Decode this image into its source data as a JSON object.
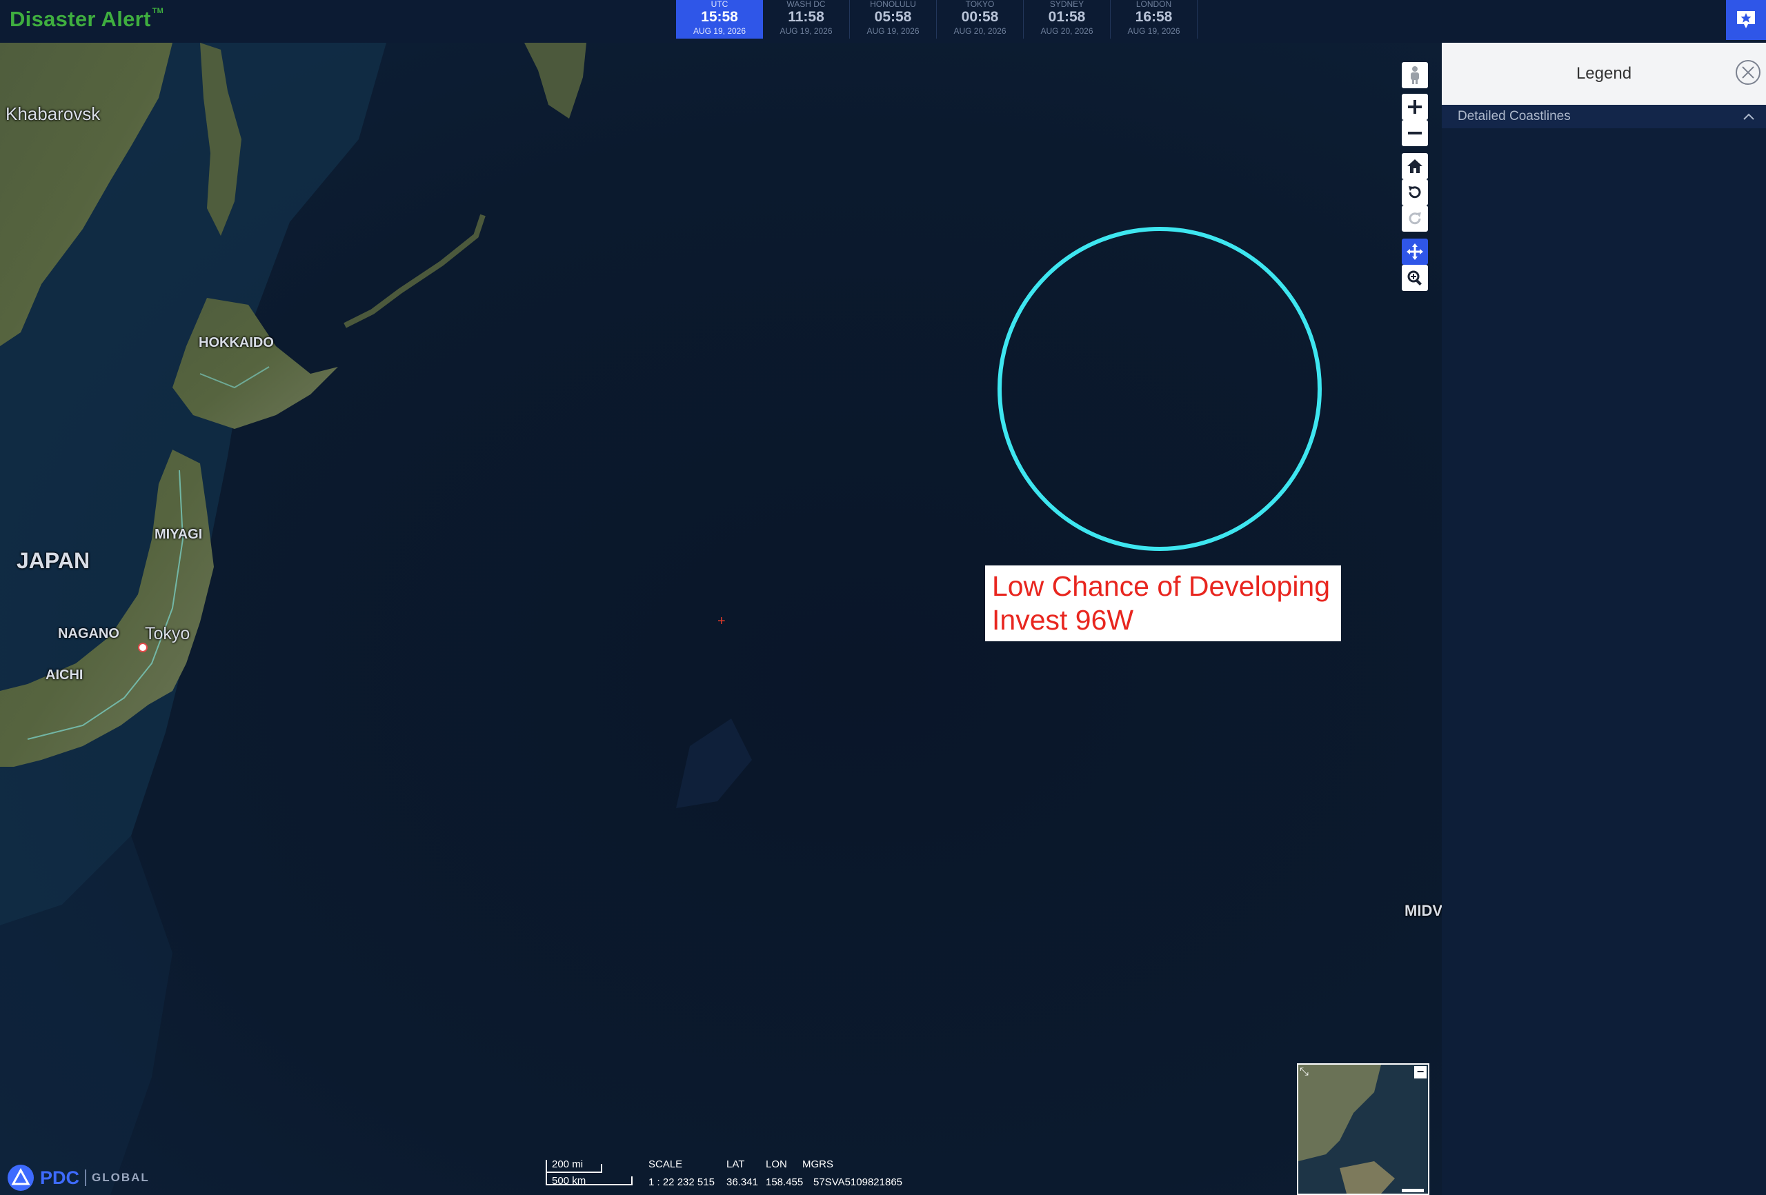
{
  "app": {
    "title": "Disaster Alert",
    "trademark": "TM"
  },
  "clocks": [
    {
      "zone": "UTC",
      "time": "15:58",
      "date": "AUG 19, 2026",
      "active": true
    },
    {
      "zone": "WASH DC",
      "time": "11:58",
      "date": "AUG 19, 2026"
    },
    {
      "zone": "HONOLULU",
      "time": "05:58",
      "date": "AUG 19, 2026"
    },
    {
      "zone": "TOKYO",
      "time": "00:58",
      "date": "AUG 20, 2026"
    },
    {
      "zone": "SYDNEY",
      "time": "01:58",
      "date": "AUG 20, 2026"
    },
    {
      "zone": "LONDON",
      "time": "16:58",
      "date": "AUG 19, 2026"
    }
  ],
  "map": {
    "places": {
      "khabarovsk": "Khabarovsk",
      "hokkaido": "HOKKAIDO",
      "japan": "JAPAN",
      "miyagi": "MIYAGI",
      "nagano": "NAGANO",
      "tokyo": "Tokyo",
      "aichi": "AICHI",
      "midway": "MIDV"
    },
    "storm": {
      "line1": "Low Chance of Developing",
      "line2": "Invest 96W",
      "ring_color": "#3ee6f0"
    },
    "controls": [
      "pegman-icon",
      "zoom-in-icon",
      "zoom-out-icon",
      "home-icon",
      "rotate-left-icon",
      "rotate-right-icon",
      "pan-icon",
      "zoom-box-icon"
    ]
  },
  "legend": {
    "title": "Legend",
    "items": [
      {
        "label": "Detailed Coastlines",
        "expanded": true
      }
    ]
  },
  "status": {
    "brand": "PDC",
    "brand_suffix": "GLOBAL",
    "scale_mi": "200 mi",
    "scale_km": "500 km",
    "scale_label": "SCALE",
    "scale_value": "1 : 22 232 515",
    "lat_label": "LAT",
    "lat_value": "36.341",
    "lon_label": "LON",
    "lon_value": "158.455",
    "mgrs_label": "MGRS",
    "mgrs_value": "57SVA5109821865"
  },
  "colors": {
    "accent": "#2f56e8",
    "brand_green": "#3fae3f",
    "storm_text": "#e8261f"
  }
}
